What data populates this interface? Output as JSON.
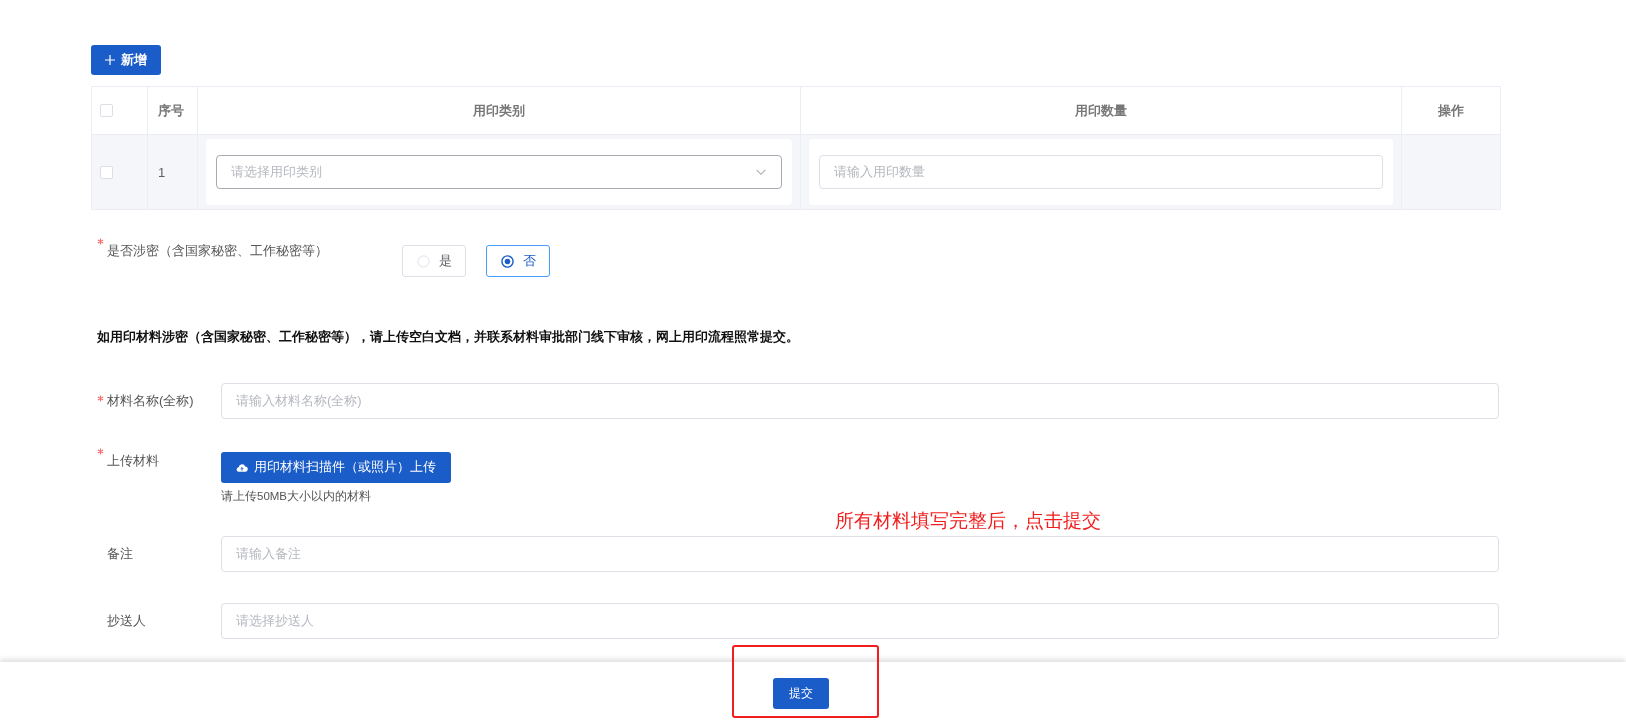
{
  "toolbar": {
    "add_button": "新增"
  },
  "table": {
    "header_checkbox": {
      "checked": false
    },
    "columns": [
      "序号",
      "用印类别",
      "用印数量",
      "操作"
    ],
    "rows": [
      {
        "checked": false,
        "index": "1",
        "category": {
          "placeholder": "请选择用印类别"
        },
        "quantity": {
          "placeholder": "请输入用印数量"
        }
      }
    ]
  },
  "secret": {
    "label": "是否涉密（含国家秘密、工作秘密等）",
    "required": true,
    "options": [
      {
        "label": "是",
        "selected": false
      },
      {
        "label": "否",
        "selected": true
      }
    ]
  },
  "notice": "如用印材料涉密（含国家秘密、工作秘密等），请上传空白文档，并联系材料审批部门线下审核，网上用印流程照常提交。",
  "fields": [
    {
      "kind": "input",
      "label": "材料名称(全称)",
      "required": true,
      "placeholder": "请输入材料名称(全称)"
    },
    {
      "kind": "upload",
      "label": "上传材料",
      "required": true,
      "button": "用印材料扫描件（或照片）上传",
      "hint": "请上传50MB大小以内的材料"
    },
    {
      "kind": "input",
      "label": "备注",
      "required": false,
      "placeholder": "请输入备注"
    },
    {
      "kind": "select",
      "label": "抄送人",
      "required": false,
      "placeholder": "请选择抄送人"
    }
  ],
  "footer": {
    "submit_button": "提交"
  },
  "annotation": {
    "text": "所有材料填写完整后，点击提交"
  }
}
